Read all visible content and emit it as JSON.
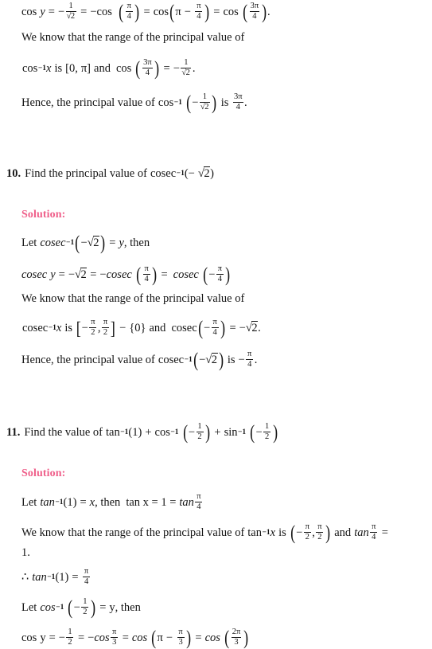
{
  "document": {
    "type": "math-solutions-page",
    "background_color": "#ffffff",
    "text_color": "#141414",
    "solution_label_color": "#ef5f8a"
  },
  "continuation": {
    "lines": [
      "cos y = − 1/√2 = −cos (π/4) = cos (π − π/4) = cos (3π/4).",
      "We know that the range of the principal value of",
      "cos⁻¹x is [0, π] and cos (3π/4) = − 1/√2.",
      "Hence, the principal value of cos⁻¹ (− 1/√2) is 3π/4."
    ]
  },
  "problems": [
    {
      "number": "10.",
      "question": "Find the principal value of cosec⁻¹(− √2)",
      "solution_label": "Solution:",
      "steps": [
        "Let cosec⁻¹(−√2) = y, then",
        "cosec y = −√2 = −cosec (π/4) = cosec (− π/4)",
        "We know that the range of the principal value of",
        "cosec⁻¹x is [− π/2 , π/2] − {0} and cosec (− π/4) = −√2.",
        "Hence, the principal value of cosec⁻¹(−√2) is − π/4."
      ]
    },
    {
      "number": "11.",
      "question": "Find the value of tan⁻¹(1) + cos⁻¹ (− 1/2) + sin⁻¹ (− 1/2)",
      "solution_label": "Solution:",
      "steps": [
        "Let tan⁻¹(1) = x, then tan x = 1 = tan π/4",
        "We know that the range of the principal value of tan⁻¹x is (− π/2 , π/2) and tan π/4 = 1.",
        "∴ tan⁻¹(1) = π/4",
        "Let cos⁻¹ (− 1/2) = y, then",
        "cos y = − 1/2 = −cos π/3 = cos (π − π/3) = cos (2π/3)"
      ]
    }
  ],
  "tokens": {
    "cos": "cos",
    "cosec": "cosec",
    "tan": "tan",
    "sin": "sin",
    "y": "y",
    "x": "x",
    "inv": "−1",
    "eq": "=",
    "plus": "+",
    "minus": "−",
    "pi": "π",
    "one": "1",
    "two": "2",
    "three": "3",
    "four": "4",
    "zero": "0",
    "three_pi": "3π",
    "two_pi": "2π",
    "sqrt_sign": "√",
    "zero_set": "{0}",
    "therefore": "∴",
    "we_know": "We know that the range of the principal value of",
    "we_know_inline": "We know that the range of the principal value of",
    "hence": "Hence, the principal value of",
    "is": "is",
    "and": "and",
    "then": ", then",
    "let": "Let",
    "find_principal": "Find the principal value of",
    "find_value": "Find the value of",
    "period": ".",
    "comma": ",",
    "tan_x_is": "tan x = 1 =",
    "one_period": "1."
  }
}
